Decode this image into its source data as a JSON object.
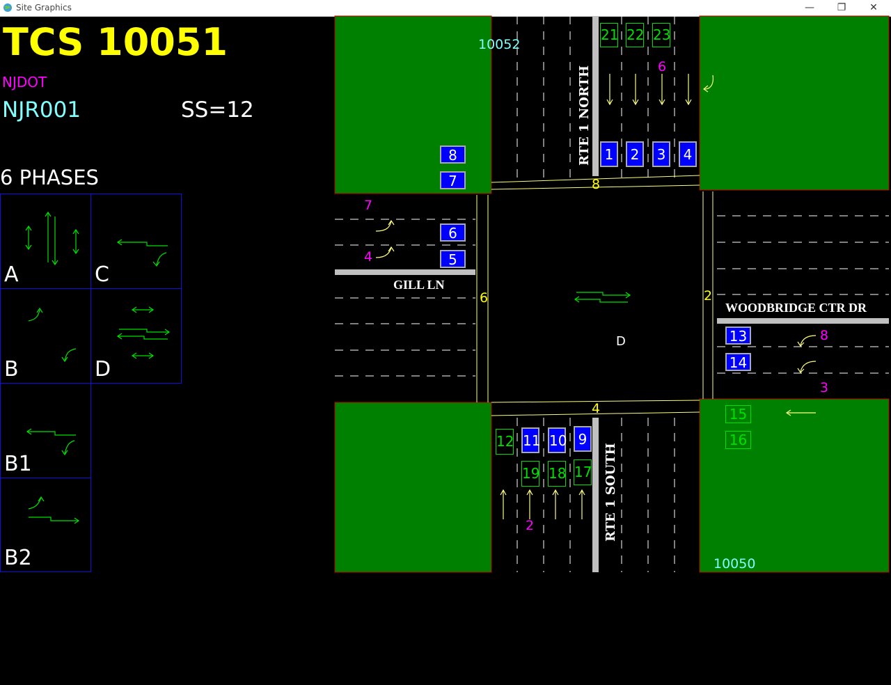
{
  "window": {
    "title": "Site Graphics",
    "minimize": "—",
    "restore": "❐",
    "close": "✕",
    "icon": "globe-icon"
  },
  "header": {
    "tcs": "TCS 10051",
    "agency": "NJDOT",
    "system": "NJR001",
    "ss": "SS=12",
    "phases_title": "6 PHASES"
  },
  "phases": [
    "A",
    "C",
    "B",
    "D",
    "B1",
    "B2"
  ],
  "streets": {
    "north": "RTE 1 NORTH",
    "south": "RTE 1 SOUTH",
    "west": "GILL LN",
    "east": "WOODBRIDGE CTR DR"
  },
  "adjacent": {
    "north": "10052",
    "south": "10050"
  },
  "intersection_phase": "D",
  "approach_numbers": {
    "north": "8",
    "south": "4",
    "west": "6",
    "east": "2"
  },
  "movement_numbers": {
    "sb": "6",
    "nb": "2",
    "eb_upper": "7",
    "eb_lower": "4",
    "wb_upper": "8",
    "wb_lower": "3"
  },
  "detectors": {
    "blue": [
      "8",
      "7",
      "6",
      "5",
      "1",
      "2",
      "3",
      "4",
      "13",
      "14",
      "12",
      "11",
      "10",
      "9"
    ],
    "green": [
      "21",
      "22",
      "23",
      "15",
      "16",
      "19",
      "18",
      "17"
    ]
  },
  "colors": {
    "background": "#000000",
    "grass": "#008000",
    "title_yellow": "#ffff00",
    "agency_magenta": "#ff00ff",
    "cyan": "#80ffff",
    "detector_blue": "#0000ff",
    "detector_green": "#00e000",
    "phase_border": "#1010e0",
    "lane_line": "#ffffff",
    "curb": "#c0c0c0",
    "stop_bar": "#ffff80"
  }
}
